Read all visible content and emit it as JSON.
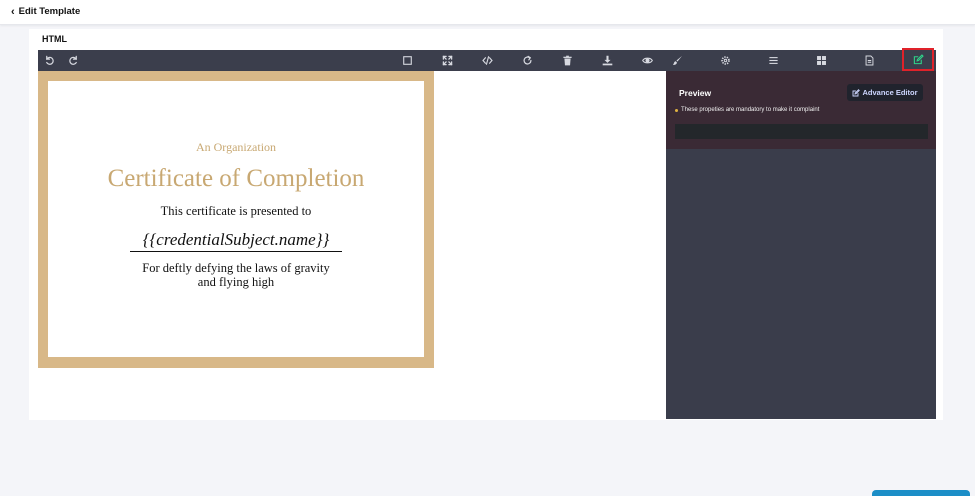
{
  "header": {
    "back_label": "Edit Template"
  },
  "editor": {
    "section_label": "HTML"
  },
  "toolbar": {
    "buttons": [
      {
        "name": "undo",
        "icon": "undo-icon"
      },
      {
        "name": "redo",
        "icon": "redo-icon"
      },
      {
        "name": "borders",
        "icon": "square-icon"
      },
      {
        "name": "fullscreen",
        "icon": "fullscreen-icon"
      },
      {
        "name": "code",
        "icon": "code-icon"
      },
      {
        "name": "refresh",
        "icon": "refresh-icon"
      },
      {
        "name": "delete",
        "icon": "trash-icon"
      },
      {
        "name": "download",
        "icon": "download-icon"
      },
      {
        "name": "preview",
        "icon": "eye-icon"
      },
      {
        "name": "style-manager",
        "icon": "brush-icon"
      },
      {
        "name": "settings",
        "icon": "gear-icon"
      },
      {
        "name": "layers",
        "icon": "menu-icon"
      },
      {
        "name": "blocks",
        "icon": "grid-icon"
      },
      {
        "name": "pages",
        "icon": "document-icon"
      },
      {
        "name": "edit",
        "icon": "edit-icon",
        "active": true
      }
    ],
    "icon_color": "#d7d9e0",
    "active_icon_color": "#2fd38a",
    "active_border_color": "#e0222a"
  },
  "certificate": {
    "organization": "An Organization",
    "title": "Certificate of Completion",
    "presented_text": "This certificate is presented to",
    "subject": "{{credentialSubject.name}}",
    "reason_line1": "For deftly defying the laws of gravity",
    "reason_line2": "and flying high",
    "frame_color": "#d8b888",
    "accent_color": "#c8a872"
  },
  "panel": {
    "preview_label": "Preview",
    "advance_editor_label": "Advance Editor",
    "note_text": "These propeties are mandatory to make it complaint"
  }
}
